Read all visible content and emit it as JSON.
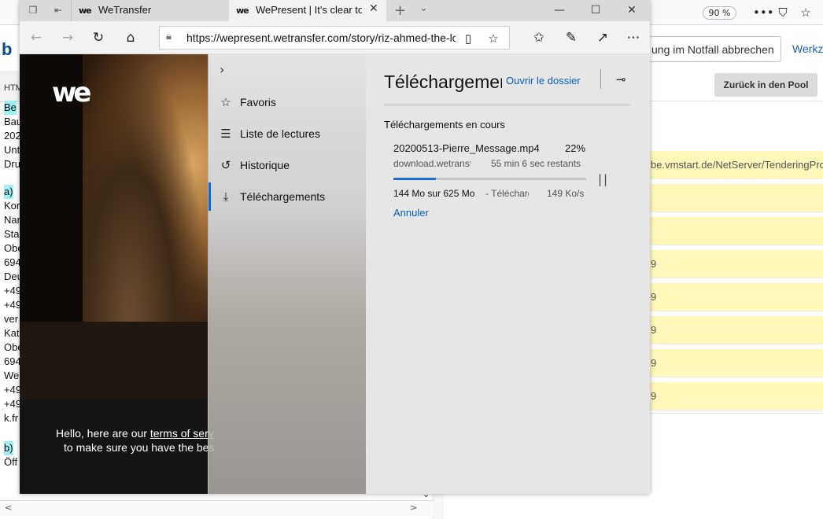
{
  "background_window": {
    "zoom": "90 %",
    "left_heading_fragment": "b",
    "left_tab_fragment": "HTM",
    "left_lines": [
      "Be",
      "Bau",
      "202",
      "Unt",
      "Dru",
      "a)",
      "Kor",
      "Nar",
      "Stac",
      "Obe",
      "694",
      "Deu",
      "+49",
      "+49",
      "ver",
      "Kat",
      "Obe",
      "694",
      "We",
      "+49",
      "+49",
      "k.fr",
      "b)",
      "Öff"
    ],
    "right_input_text": "ung im Notfall abbrechen",
    "right_link": "Werkz",
    "pool_button": "Zurück in den Pool",
    "right_rows": [
      "be.vmstart.de/NetServer/TenderingPro",
      "",
      "",
      "9",
      "9",
      "9",
      "9",
      "9"
    ]
  },
  "edge": {
    "tabs": [
      {
        "logo": "we",
        "title": "WeTransfer"
      },
      {
        "logo": "we",
        "title": "WePresent | It's clear to"
      }
    ],
    "url": "https://wepresent.wetransfer.com/story/riz-ahmed-the-long",
    "page": {
      "logo": "we",
      "cookie_line1_prefix": "Hello, here are our ",
      "cookie_link": "terms of serv",
      "cookie_line2": "to make sure you have the bes"
    },
    "hub": {
      "items": [
        {
          "icon": "favorites-icon",
          "glyph": "☆",
          "label": "Favoris"
        },
        {
          "icon": "reading-list-icon",
          "glyph": "☰",
          "label": "Liste de lectures"
        },
        {
          "icon": "history-icon",
          "glyph": "↺",
          "label": "Historique"
        },
        {
          "icon": "downloads-icon",
          "glyph": "⤓",
          "label": "Téléchargements"
        }
      ],
      "title": "Téléchargements",
      "open_folder": "Ouvrir le dossier",
      "section": "Téléchargements en cours",
      "download": {
        "filename": "20200513-Pierre_Message.mp4",
        "percent": "22%",
        "progress": 0.22,
        "source": "download.wetransfer.com",
        "remaining": "55 min 6 sec restants",
        "size": "144 Mo sur 625 Mo",
        "via": "- Téléchargement",
        "speed": "149 Ko/s",
        "cancel": "Annuler"
      }
    }
  },
  "colors": {
    "accent": "#0b68d4",
    "link": "#0b5cc0",
    "row_highlight": "#fff8b8",
    "left_highlight": "#9ef0f3"
  }
}
